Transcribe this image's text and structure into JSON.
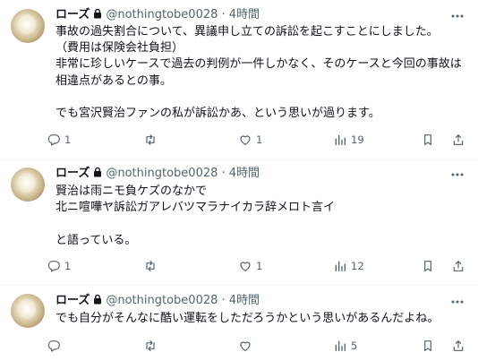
{
  "tweets": [
    {
      "name": "ローズ",
      "meta": "@nothingtobe0028 · 4時間",
      "text": "事故の過失割合について、異議申し立ての訴訟を起こすことにしました。\n（費用は保険会社負担）\n非常に珍しいケースで過去の判例が一件しかなく、そのケースと今回の事故は相違点があるとの事。\n\nでも宮沢賢治ファンの私が訴訟かあ、という思いが過ります。",
      "replies": "1",
      "retweets": "",
      "likes": "1",
      "views": "19"
    },
    {
      "name": "ローズ",
      "meta": "@nothingtobe0028 · 4時間",
      "text": "賢治は雨ニモ負ケズのなかで\n北ニ喧嘩ヤ訴訟ガアレバツマラナイカラ辞メロト言イ\n\nと語っている。",
      "replies": "1",
      "retweets": "",
      "likes": "1",
      "views": "12"
    },
    {
      "name": "ローズ",
      "meta": "@nothingtobe0028 · 4時間",
      "text": "でも自分がそんなに酷い運転をしただろうかという思いがあるんだよね。",
      "replies": "",
      "retweets": "",
      "likes": "",
      "views": "5"
    }
  ],
  "icons": {
    "reply": "reply-icon",
    "retweet": "retweet-icon",
    "like": "like-icon",
    "views": "views-icon",
    "share": "share-icon",
    "more": "more-icon",
    "lock": "lock-icon"
  },
  "colors": {
    "secondary_text": "#536471",
    "divider": "#eff3f4",
    "text": "#0f1419"
  }
}
